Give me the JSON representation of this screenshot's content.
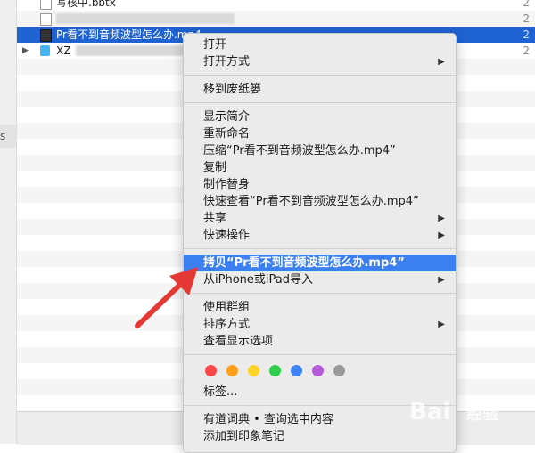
{
  "file_list": {
    "rows": [
      {
        "name": "写核中.bbtx",
        "date": "2",
        "icon": "document-icon"
      },
      {
        "name": "",
        "date": "2",
        "icon": "music-file-icon"
      },
      {
        "name": "Pr看不到音频波型怎么办.mp4",
        "date": "2",
        "icon": "video-file-icon"
      },
      {
        "name": "XZ",
        "date": "2",
        "icon": "folder-icon"
      }
    ]
  },
  "gutter": {
    "marker": "s"
  },
  "menu": {
    "open": "打开",
    "open_with": "打开方式",
    "move_to_trash": "移到废纸篓",
    "get_info": "显示简介",
    "rename": "重新命名",
    "compress": "压缩“Pr看不到音频波型怎么办.mp4”",
    "duplicate": "复制",
    "make_alias": "制作替身",
    "quick_look": "快速查看“Pr看不到音频波型怎么办.mp4”",
    "share": "共享",
    "quick_actions": "快速操作",
    "copy_item": "拷贝“Pr看不到音频波型怎么办.mp4”",
    "import_from_device": "从iPhone或iPad导入",
    "use_groups": "使用群组",
    "sort_by": "排序方式",
    "show_view_options": "查看显示选项",
    "tags": "标签...",
    "dictionary_lookup": "有道词典 • 查询选中内容",
    "add_to_evernote": "添加到印象笔记"
  },
  "tag_colors": [
    "#ff4747",
    "#ff9f1a",
    "#ffd426",
    "#2fcf4e",
    "#3c82f6",
    "#b45ad8",
    "#9a9a9a"
  ],
  "watermark": {
    "text": "Bai",
    "sub": "经验"
  }
}
